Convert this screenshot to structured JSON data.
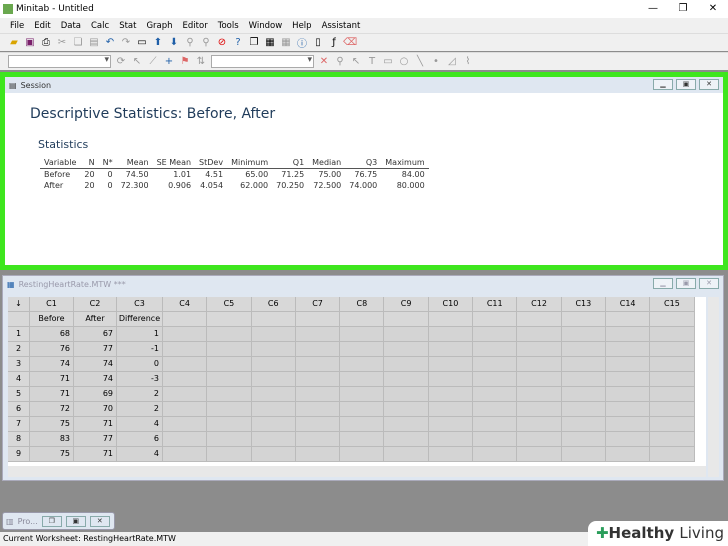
{
  "app": {
    "title": "Minitab - Untitled"
  },
  "menu": [
    "File",
    "Edit",
    "Data",
    "Calc",
    "Stat",
    "Graph",
    "Editor",
    "Tools",
    "Window",
    "Help",
    "Assistant"
  ],
  "session": {
    "window_title": "Session",
    "heading": "Descriptive Statistics: Before, After",
    "subheading": "Statistics",
    "columns": [
      "Variable",
      "N",
      "N*",
      "Mean",
      "SE Mean",
      "StDev",
      "Minimum",
      "Q1",
      "Median",
      "Q3",
      "Maximum"
    ],
    "rows": [
      [
        "Before",
        "20",
        "0",
        "74.50",
        "1.01",
        "4.51",
        "65.00",
        "71.25",
        "75.00",
        "76.75",
        "84.00"
      ],
      [
        "After",
        "20",
        "0",
        "72.300",
        "0.906",
        "4.054",
        "62.000",
        "70.250",
        "72.500",
        "74.000",
        "80.000"
      ]
    ]
  },
  "worksheet": {
    "title": "RestingHeartRate.MTW ***",
    "corner": "↓",
    "col_ids": [
      "C1",
      "C2",
      "C3",
      "C4",
      "C5",
      "C6",
      "C7",
      "C8",
      "C9",
      "C10",
      "C11",
      "C12",
      "C13",
      "C14",
      "C15"
    ],
    "col_names": [
      "Before",
      "After",
      "Difference",
      "",
      "",
      "",
      "",
      "",
      "",
      "",
      "",
      "",
      "",
      "",
      ""
    ],
    "rows": [
      [
        "1",
        "68",
        "67",
        "1"
      ],
      [
        "2",
        "76",
        "77",
        "-1"
      ],
      [
        "3",
        "74",
        "74",
        "0"
      ],
      [
        "4",
        "71",
        "74",
        "-3"
      ],
      [
        "5",
        "71",
        "69",
        "2"
      ],
      [
        "6",
        "72",
        "70",
        "2"
      ],
      [
        "7",
        "75",
        "71",
        "4"
      ],
      [
        "8",
        "83",
        "77",
        "6"
      ],
      [
        "9",
        "75",
        "71",
        "4"
      ]
    ]
  },
  "minimized": {
    "label": "Pro..."
  },
  "status": {
    "text": "Current Worksheet: RestingHeartRate.MTW"
  },
  "watermark": {
    "text1": "Healthy",
    "text2": "Living"
  }
}
